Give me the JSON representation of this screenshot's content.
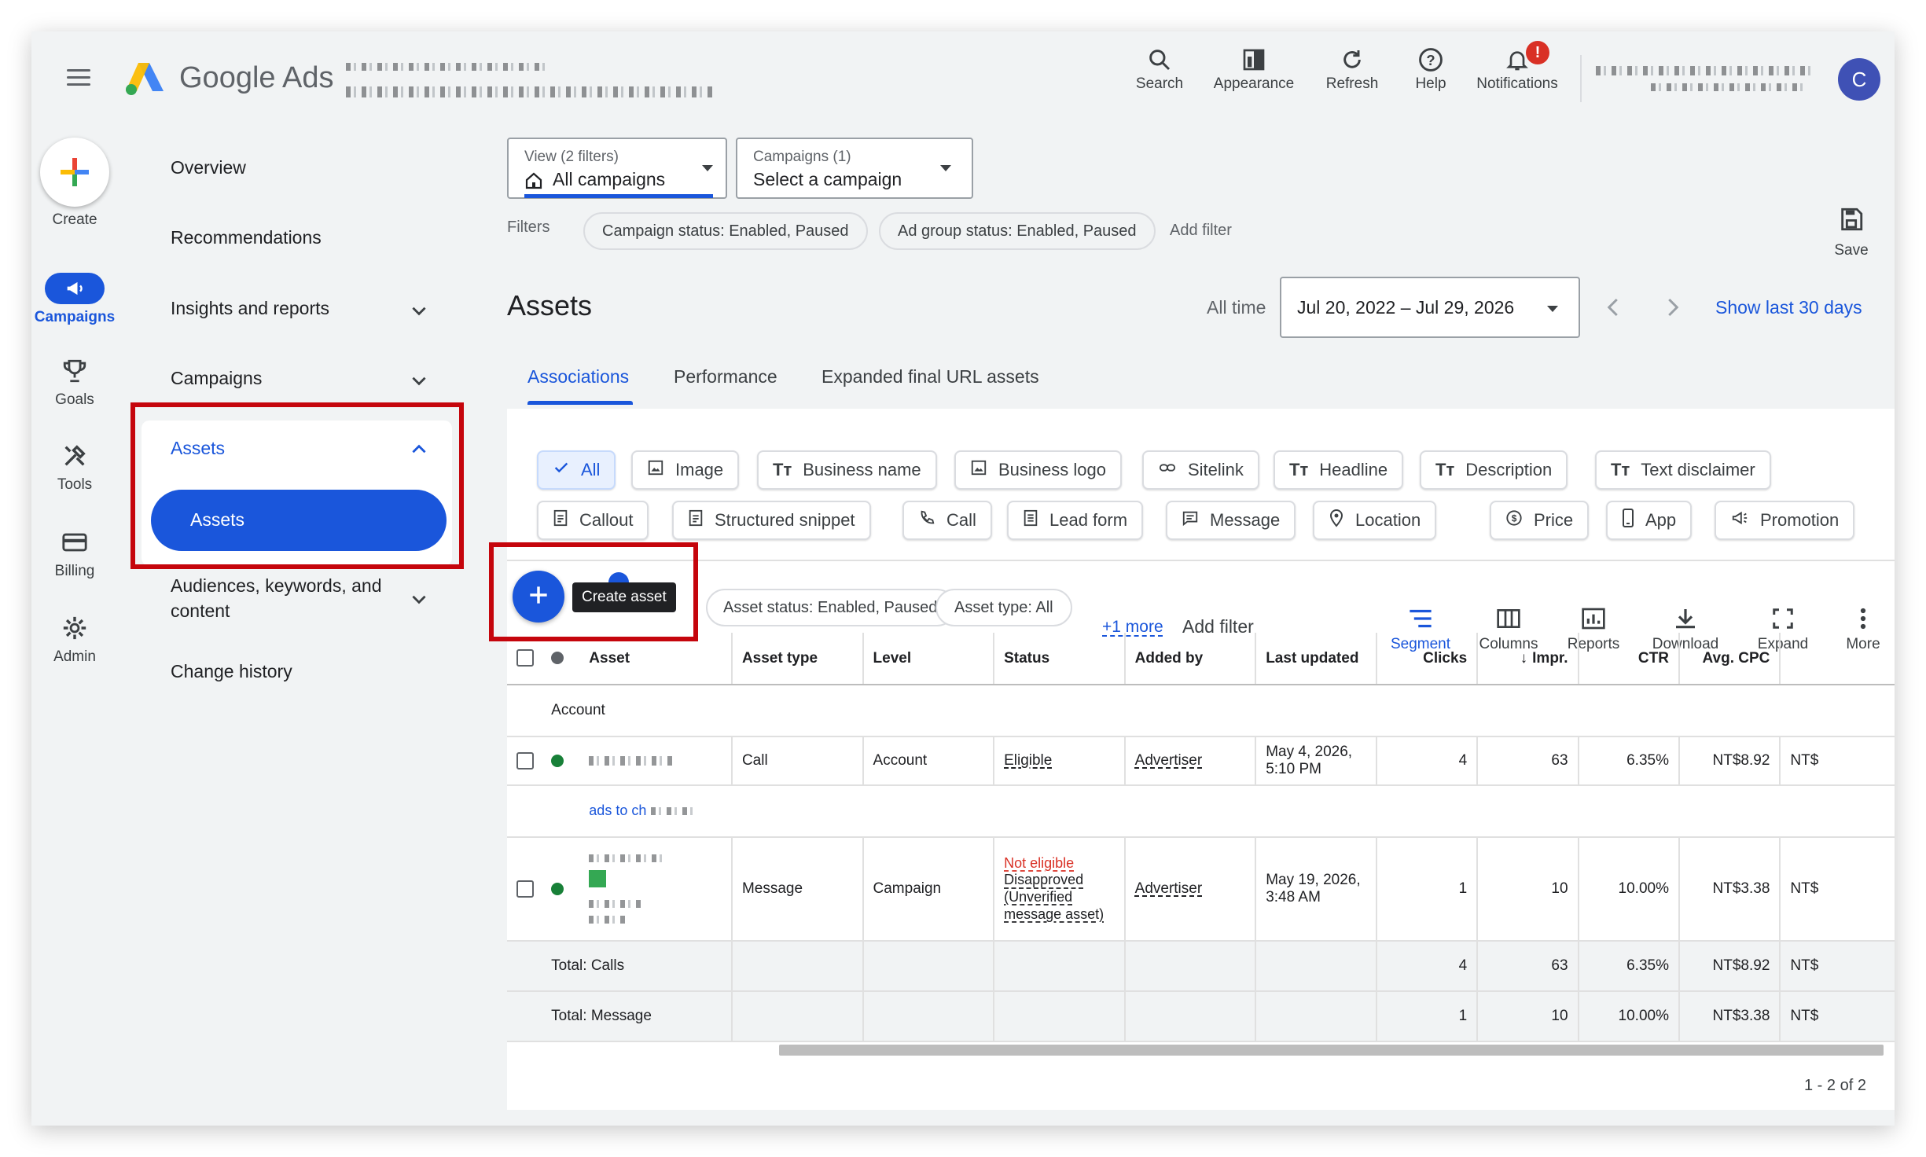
{
  "header": {
    "app_name": "Google Ads",
    "top_buttons": [
      "Search",
      "Appearance",
      "Refresh",
      "Help",
      "Notifications"
    ],
    "notification_badge": "!",
    "avatar_letter": "C"
  },
  "rail": {
    "create": "Create",
    "items": [
      "Campaigns",
      "Goals",
      "Tools",
      "Billing",
      "Admin"
    ]
  },
  "nav": {
    "overview": "Overview",
    "recommendations": "Recommendations",
    "insights": "Insights and reports",
    "campaigns": "Campaigns",
    "assets": "Assets",
    "assets_sub": "Assets",
    "audiences_line1": "Audiences, keywords, and",
    "audiences_line2": "content",
    "change_history": "Change history"
  },
  "filters_bar": {
    "view_label": "View (2 filters)",
    "view_value": "All campaigns",
    "campaign_label": "Campaigns (1)",
    "campaign_value": "Select a campaign",
    "filters_label": "Filters",
    "chip1": "Campaign status: Enabled, Paused",
    "chip2": "Ad group status: Enabled, Paused",
    "add_filter": "Add filter",
    "save": "Save"
  },
  "page": {
    "title": "Assets",
    "all_time": "All time",
    "date_range": "Jul 20, 2022 – Jul 29, 2026",
    "show_last": "Show last 30 days"
  },
  "tabs": [
    "Associations",
    "Performance",
    "Expanded final URL assets"
  ],
  "asset_types_row1": [
    "All",
    "Image",
    "Business name",
    "Business logo",
    "Sitelink",
    "Headline",
    "Description",
    "Text disclaimer"
  ],
  "asset_types_row2": [
    "Callout",
    "Structured snippet",
    "Call",
    "Lead form",
    "Message",
    "Location",
    "Price",
    "App",
    "Promotion"
  ],
  "table_toolbar": {
    "tooltip": "Create asset",
    "chip_status": "Asset status: Enabled, Paused",
    "chip_type": "Asset type: All",
    "more_filters": "+1 more",
    "add_filter": "Add filter",
    "tools": [
      "Segment",
      "Columns",
      "Reports",
      "Download",
      "Expand",
      "More"
    ]
  },
  "table": {
    "headers": [
      "Asset",
      "Asset type",
      "Level",
      "Status",
      "Added by",
      "Last updated",
      "Clicks",
      "Impr.",
      "CTR",
      "Avg. CPC"
    ],
    "group_label": "Account",
    "rows": [
      {
        "type": "Call",
        "level": "Account",
        "status": "Eligible",
        "added_by": "Advertiser",
        "updated1": "May 4, 2026,",
        "updated2": "5:10 PM",
        "clicks": "4",
        "impr": "63",
        "ctr": "6.35%",
        "cpc": "NT$8.92",
        "cost": "NT$"
      },
      {
        "type": "Message",
        "level": "Campaign",
        "status_bad": "Not eligible",
        "status2": "Disapproved",
        "status3": "(Unverified",
        "status4": "message asset)",
        "added_by": "Advertiser",
        "updated1": "May 19, 2026,",
        "updated2": "3:48 AM",
        "clicks": "1",
        "impr": "10",
        "ctr": "10.00%",
        "cpc": "NT$3.38",
        "cost": "NT$"
      }
    ],
    "link_text": "ads to ch",
    "totals": [
      {
        "label": "Total: Calls",
        "clicks": "4",
        "impr": "63",
        "ctr": "6.35%",
        "cpc": "NT$8.92",
        "cost": "NT$"
      },
      {
        "label": "Total: Message",
        "clicks": "1",
        "impr": "10",
        "ctr": "10.00%",
        "cpc": "NT$3.38",
        "cost": "NT$"
      }
    ],
    "pagination": "1 - 2 of 2"
  },
  "colors": {
    "accent": "#1a56db",
    "highlight": "#c5050c",
    "eligible": "#188038",
    "error": "#d93025"
  }
}
